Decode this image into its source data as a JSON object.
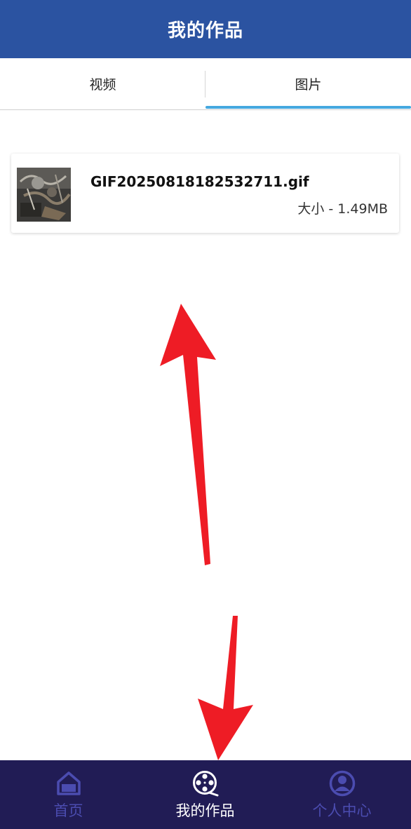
{
  "header": {
    "title": "我的作品"
  },
  "tabs": [
    {
      "label": "视频",
      "active": false
    },
    {
      "label": "图片",
      "active": true
    }
  ],
  "files": [
    {
      "name": "GIF20250818182532711.gif",
      "size": "大小 - 1.49MB",
      "thumbnail_icon": "image-thumbnail"
    }
  ],
  "bottom_nav": [
    {
      "label": "首页",
      "icon": "home-icon",
      "active": false
    },
    {
      "label": "我的作品",
      "icon": "film-reel-icon",
      "active": true
    },
    {
      "label": "个人中心",
      "icon": "user-icon",
      "active": false
    }
  ],
  "colors": {
    "header_bg": "#2b53a1",
    "tab_indicator": "#45a8df",
    "bottom_nav_bg": "#211c55",
    "nav_inactive": "#4b4cb0",
    "nav_active": "#ffffff",
    "annotation_arrow": "#ee1c25"
  }
}
